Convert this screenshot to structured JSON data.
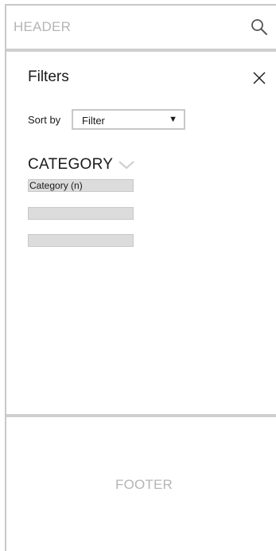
{
  "header": {
    "title": "HEADER",
    "search_icon": "search-icon"
  },
  "filters_panel": {
    "title": "Filters",
    "close_icon": "close-icon",
    "sort": {
      "label": "Sort by",
      "selected": "Filter",
      "caret": "▼"
    },
    "category": {
      "heading": "CATEGORY",
      "toggle_icon": "chevron-down-icon",
      "items": [
        {
          "label": "Category (n)"
        },
        {
          "label": ""
        },
        {
          "label": ""
        }
      ]
    }
  },
  "footer": {
    "label": "FOOTER"
  },
  "colors": {
    "border": "#c8c8c8",
    "placeholder_text": "#b5b5b5",
    "row_fill": "#dcdcdc"
  }
}
